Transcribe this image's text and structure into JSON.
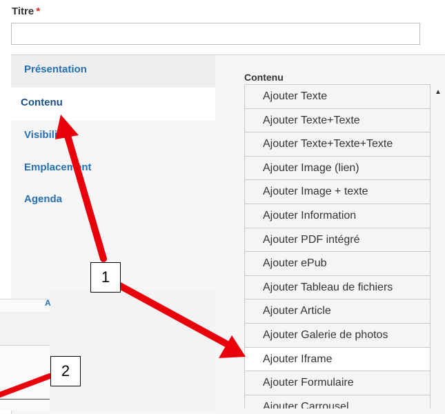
{
  "form": {
    "title_label": "Titre",
    "required_mark": "*",
    "title_value": ""
  },
  "tabs": [
    {
      "label": "Présentation"
    },
    {
      "label": "Contenu"
    },
    {
      "label": "Visibilité"
    },
    {
      "label": "Emplacement"
    },
    {
      "label": "Agenda"
    }
  ],
  "content": {
    "label": "Contenu",
    "items": [
      "Ajouter Texte",
      "Ajouter Texte+Texte",
      "Ajouter Texte+Texte+Texte",
      "Ajouter Image (lien)",
      "Ajouter Image + texte",
      "Ajouter Information",
      "Ajouter PDF intégré",
      "Ajouter ePub",
      "Ajouter Tableau de fichiers",
      "Ajouter Article",
      "Ajouter Galerie de photos",
      "Ajouter Iframe",
      "Ajouter Formulaire",
      "Ajouter Carrousel"
    ]
  },
  "annotations": {
    "callout_1": "1",
    "callout_2": "2",
    "arrow_color": "#e8000b"
  },
  "overlay_fragment": "A"
}
